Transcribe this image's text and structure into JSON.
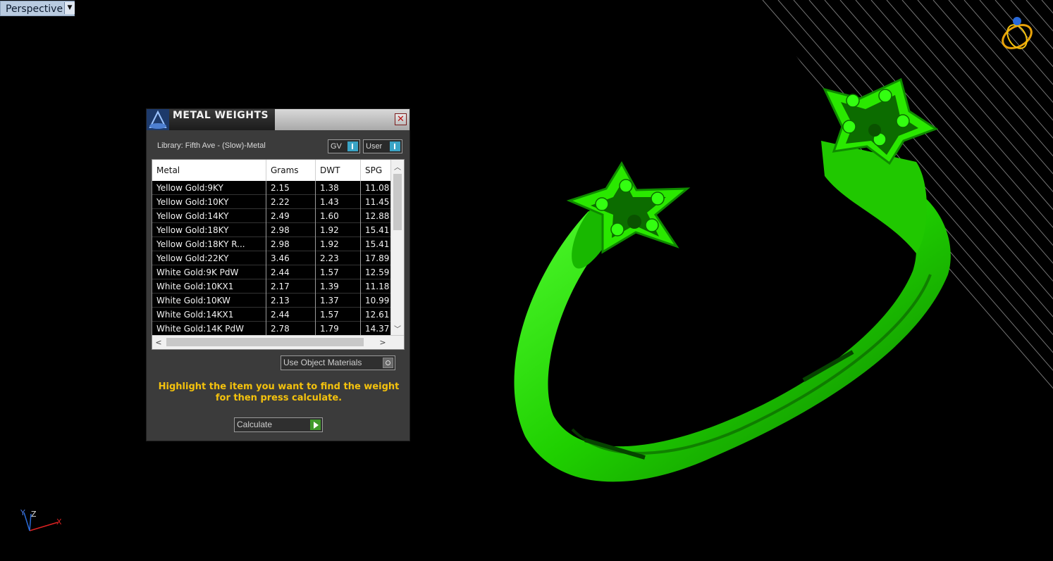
{
  "viewport": {
    "label": "Perspective",
    "dropdown_icon": "triangle-down"
  },
  "panel": {
    "title": "METAL WEIGHTS",
    "library_label": "Library: Fifth Ave - (Slow)-Metal",
    "toggle_gv": "GV",
    "toggle_user": "User",
    "columns": [
      "Metal",
      "Grams",
      "DWT",
      "SPG"
    ],
    "rows": [
      [
        "Yellow Gold:9KY",
        "2.15",
        "1.38",
        "11.08"
      ],
      [
        "Yellow Gold:10KY",
        "2.22",
        "1.43",
        "11.45"
      ],
      [
        "Yellow Gold:14KY",
        "2.49",
        "1.60",
        "12.88"
      ],
      [
        "Yellow Gold:18KY",
        "2.98",
        "1.92",
        "15.41"
      ],
      [
        "Yellow Gold:18KY R...",
        "2.98",
        "1.92",
        "15.41"
      ],
      [
        "Yellow Gold:22KY",
        "3.46",
        "2.23",
        "17.89"
      ],
      [
        "White Gold:9K PdW",
        "2.44",
        "1.57",
        "12.59"
      ],
      [
        "White Gold:10KX1",
        "2.17",
        "1.39",
        "11.18"
      ],
      [
        "White Gold:10KW",
        "2.13",
        "1.37",
        "10.99"
      ],
      [
        "White Gold:14KX1",
        "2.44",
        "1.57",
        "12.61"
      ],
      [
        "White Gold:14K PdW",
        "2.78",
        "1.79",
        "14.37"
      ]
    ],
    "use_object_materials": "Use Object Materials",
    "instructions": "Highlight the item you want to find the weight for then press calculate.",
    "calculate_label": "Calculate"
  },
  "axes": {
    "y": "Y",
    "z": "Z",
    "x": "X"
  },
  "colors": {
    "model": "#22e000",
    "highlight": "#f4c20d",
    "toggle_knob": "#3aa4c6"
  }
}
